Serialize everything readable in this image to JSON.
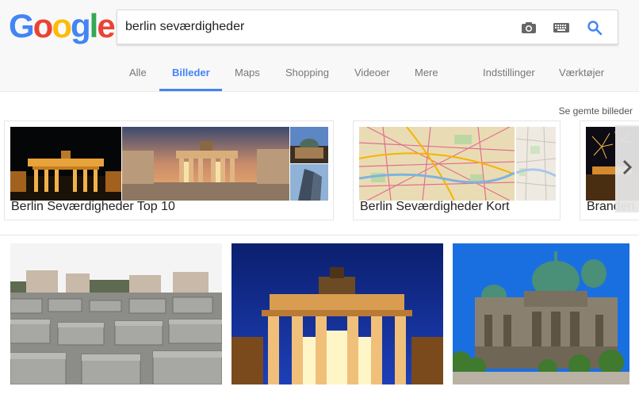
{
  "logo": {
    "letters": [
      "G",
      "o",
      "o",
      "g",
      "l",
      "e"
    ],
    "colors": [
      "#4285f4",
      "#ea4335",
      "#fbbc05",
      "#4285f4",
      "#34a853",
      "#ea4335"
    ]
  },
  "search": {
    "query": "berlin seværdigheder",
    "icons": [
      "camera-icon",
      "keyboard-icon",
      "search-icon"
    ]
  },
  "tabs": [
    {
      "label": "Alle",
      "active": false
    },
    {
      "label": "Billeder",
      "active": true
    },
    {
      "label": "Maps",
      "active": false
    },
    {
      "label": "Shopping",
      "active": false
    },
    {
      "label": "Videoer",
      "active": false
    },
    {
      "label": "Mere",
      "active": false
    },
    {
      "label": "Indstillinger",
      "active": false
    },
    {
      "label": "Værktøjer",
      "active": false
    }
  ],
  "saved_link": "Se gemte billeder",
  "collections": [
    {
      "title": "Berlin Seværdigheder Top 10"
    },
    {
      "title": "Berlin Seværdigheder Kort"
    },
    {
      "title": "Branden"
    }
  ],
  "accent": "#4285f4"
}
